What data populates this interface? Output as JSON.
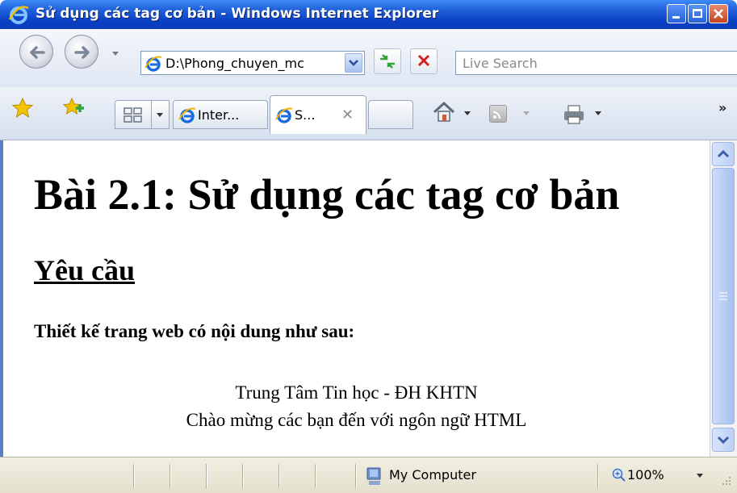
{
  "window": {
    "title": "Sử dụng các tag cơ bản - Windows Internet Explorer"
  },
  "toolbar": {
    "address": "D:\\Phong_chuyen_mc",
    "search_placeholder": "Live Search"
  },
  "tabs": [
    {
      "label": "Inter...",
      "active": false
    },
    {
      "label": "S...",
      "active": true
    }
  ],
  "page": {
    "heading": "Bài 2.1: Sử dụng các tag cơ bản",
    "subheading": "Yêu cầu",
    "requirement": "Thiết kế trang web có nội dung như sau:",
    "lines": [
      "Trung Tâm Tin học - ĐH KHTN",
      "Chào mừng các bạn đến với ngôn ngữ HTML"
    ]
  },
  "status": {
    "zone": "My Computer",
    "zoom": "100%"
  },
  "colors": {
    "titlebar": "#0a3ec4",
    "window_frame": "#5a7ec4",
    "status_bg": "#ece9d8"
  }
}
